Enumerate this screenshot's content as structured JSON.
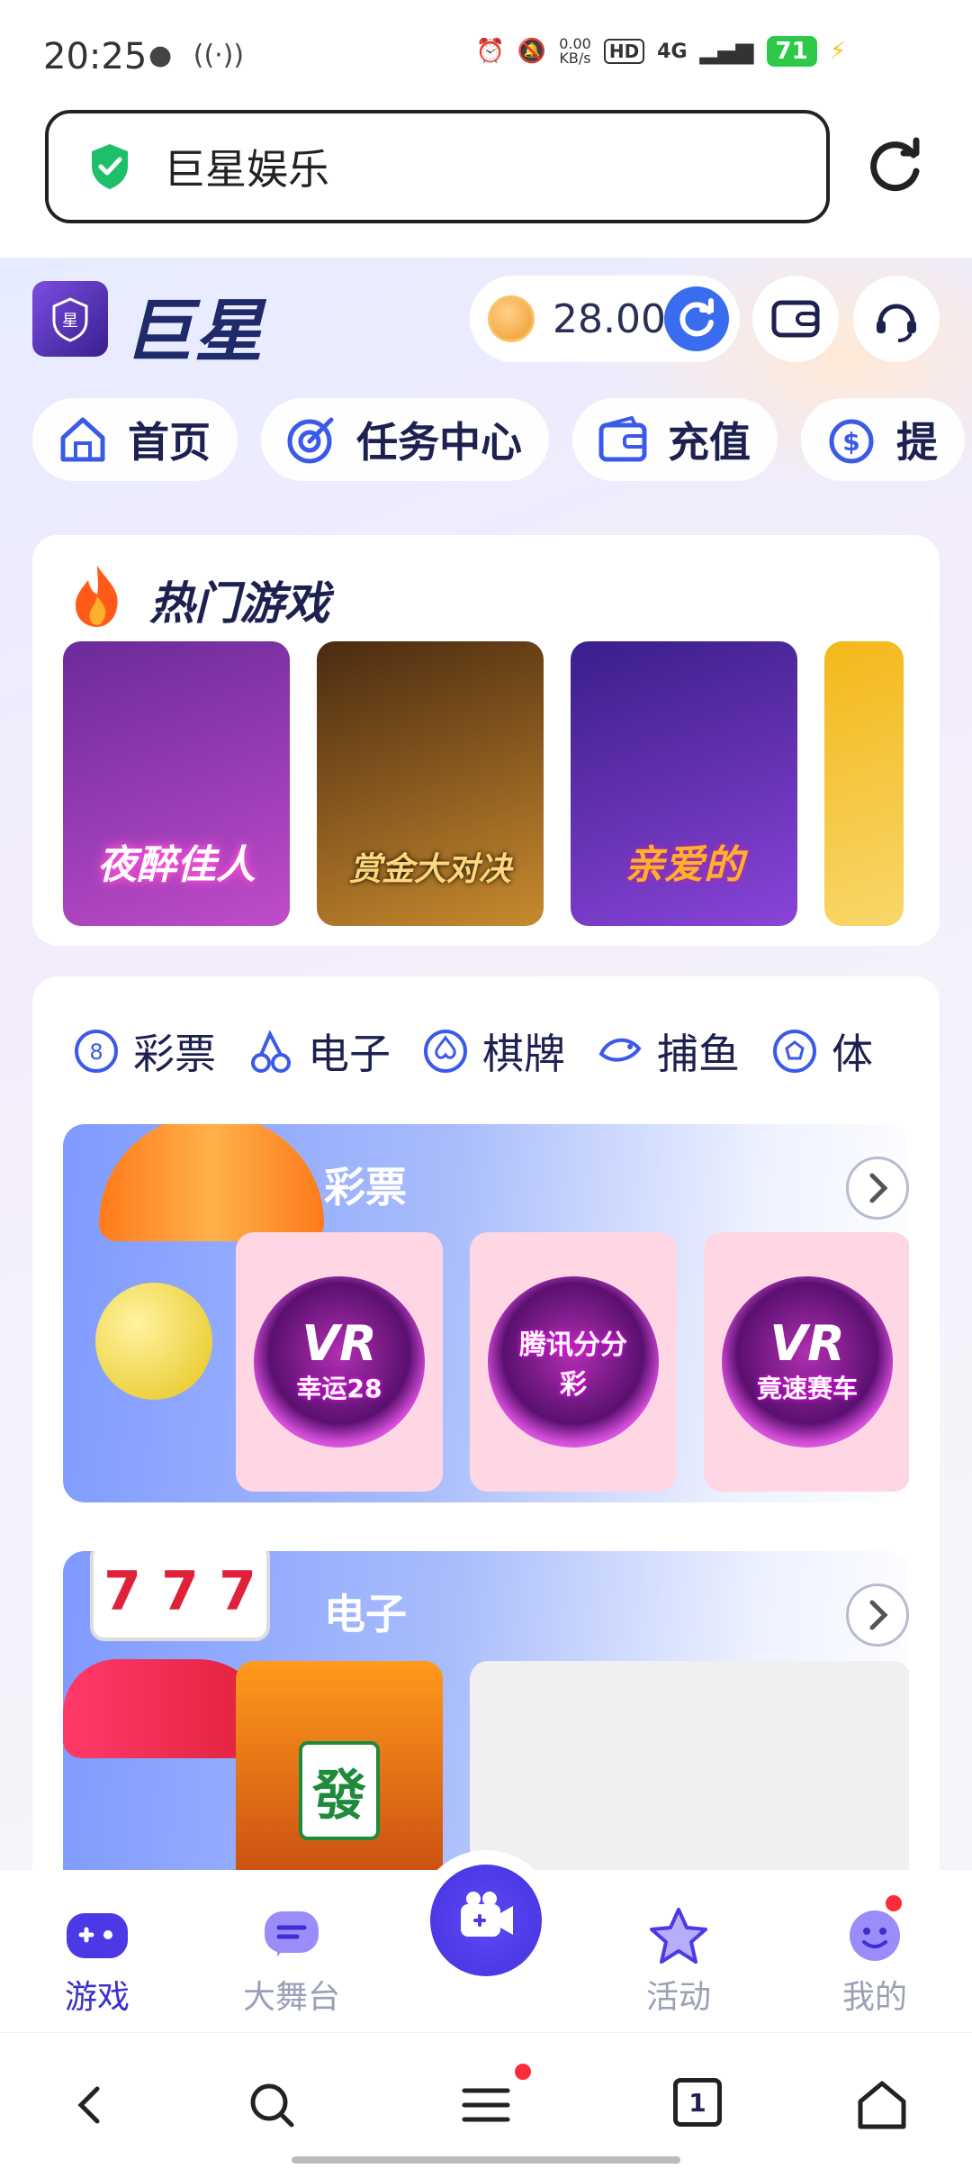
{
  "status_bar": {
    "time": "20:25",
    "net_speed_value": "0.00",
    "net_speed_unit": "KB/s",
    "hd": "HD",
    "network": "4G",
    "battery": "71"
  },
  "url_bar": {
    "title": "巨星娱乐",
    "security_icon": "shield-check-icon",
    "reload_icon": "reload-icon"
  },
  "header": {
    "brand": "巨星",
    "balance": "28.00",
    "refresh_icon": "refresh-icon",
    "wallet_icon": "wallet-icon",
    "support_icon": "headset-icon"
  },
  "nav": [
    {
      "label": "首页",
      "icon": "home-icon"
    },
    {
      "label": "任务中心",
      "icon": "target-icon"
    },
    {
      "label": "充值",
      "icon": "wallet-icon"
    },
    {
      "label": "提",
      "icon": "dollar-arrow-icon"
    }
  ],
  "hot_games": {
    "title": "热门游戏",
    "items": [
      {
        "label": "夜醉佳人",
        "color_from": "#6a2a9a",
        "color_to": "#c04cc9"
      },
      {
        "label": "赏金大对决",
        "color_from": "#4a2a10",
        "color_to": "#c88a2e"
      },
      {
        "label": "亲爱的",
        "color_from": "#3a1e8a",
        "color_to": "#8a44d8"
      },
      {
        "label": "",
        "color_from": "#f4b81a",
        "color_to": "#f8d76a"
      }
    ]
  },
  "categories": [
    {
      "label": "彩票",
      "icon": "lottery-ball-icon"
    },
    {
      "label": "电子",
      "icon": "cherries-icon"
    },
    {
      "label": "棋牌",
      "icon": "spade-icon"
    },
    {
      "label": "捕鱼",
      "icon": "fish-icon"
    },
    {
      "label": "体",
      "icon": "soccer-ball-icon"
    }
  ],
  "sections": [
    {
      "title": "彩票",
      "tiles": [
        {
          "brand": "VR",
          "label": "幸运28"
        },
        {
          "brand": "",
          "label": "腾讯分分彩"
        },
        {
          "brand": "VR",
          "label": "竟速赛车"
        }
      ]
    },
    {
      "title": "电子",
      "tiles": [
        {
          "brand": "",
          "label": "發"
        }
      ]
    }
  ],
  "tabbar": [
    {
      "label": "游戏",
      "icon": "gamepad-icon",
      "active": true
    },
    {
      "label": "大舞台",
      "icon": "chat-bubble-icon",
      "active": false
    },
    {
      "label": "",
      "icon": "video-camera-icon",
      "active": false
    },
    {
      "label": "活动",
      "icon": "star-icon",
      "active": false
    },
    {
      "label": "我的",
      "icon": "smiley-icon",
      "active": false
    }
  ],
  "system_nav": {
    "tabs_count": "1"
  },
  "colors": {
    "accent": "#3a2fd0",
    "balance_button": "#3a6cf0",
    "battery": "#2fc94a"
  }
}
